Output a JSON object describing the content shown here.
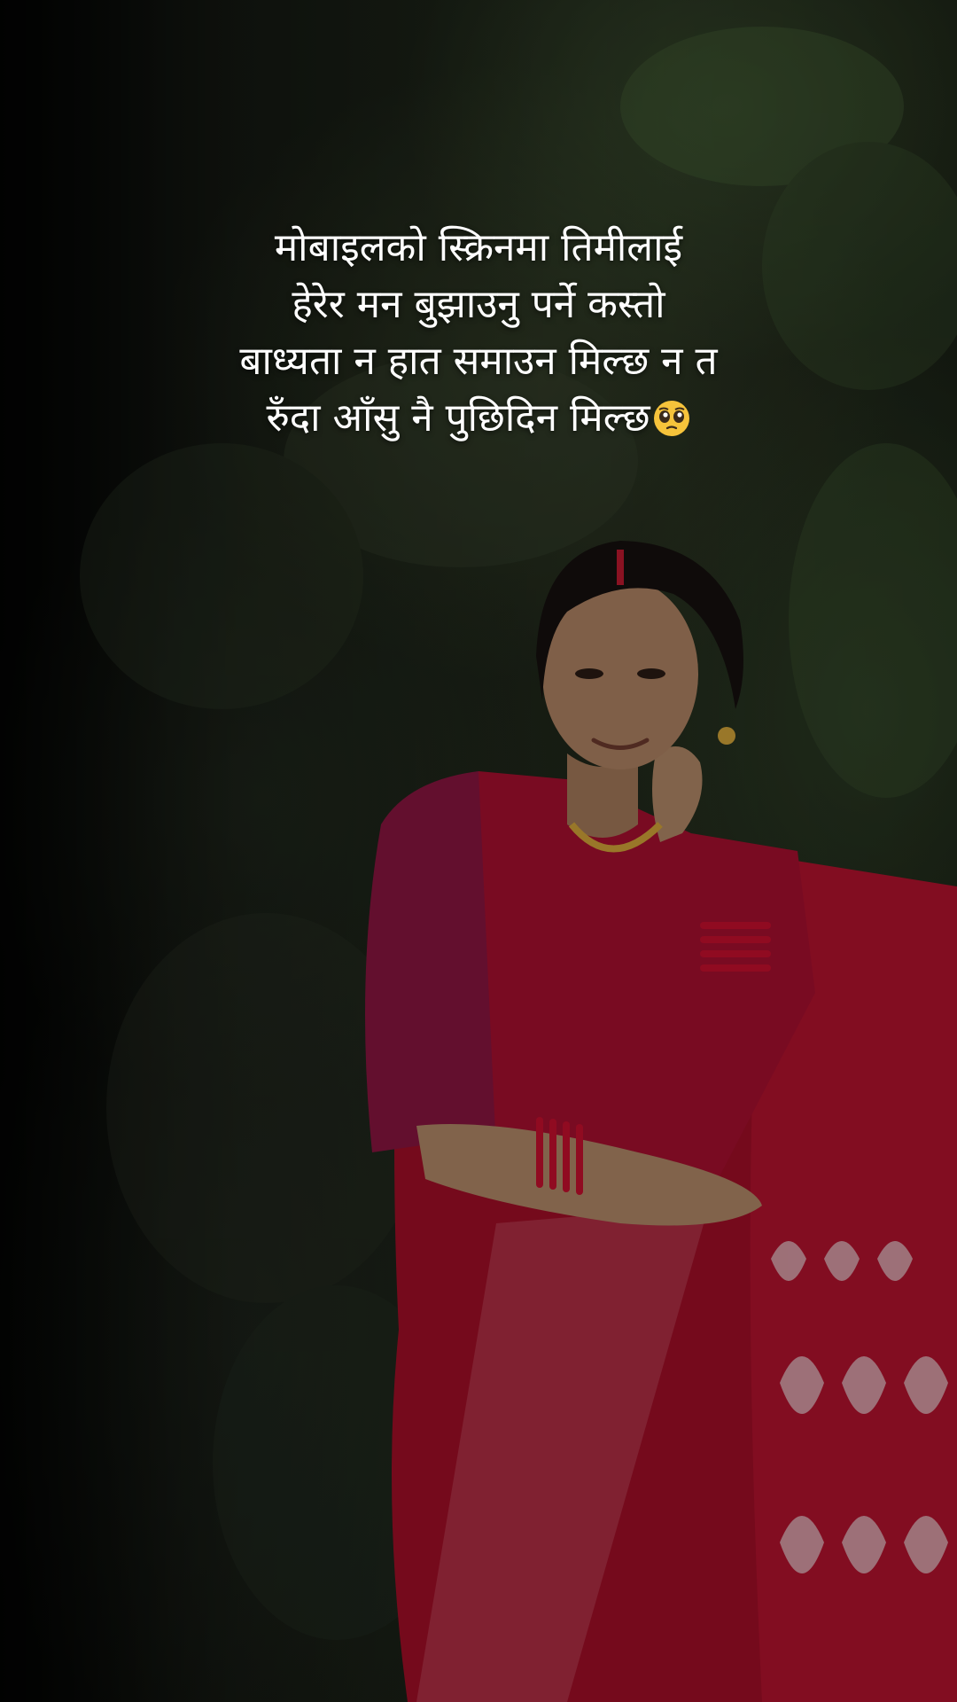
{
  "caption": {
    "line1": "मोबाइलको स्क्रिनमा तिमीलाई",
    "line2": "हेरेर मन बुझाउनु पर्ने कस्तो",
    "line3": "बाध्यता न हात समाउन मिल्छ न त",
    "line4": "रुँदा आँसु नै पुछिदिन मिल्छ",
    "emoji": "pleading-face-emoji"
  },
  "colors": {
    "saree": "#a8102a",
    "blouse": "#8a1540",
    "foliage": "#2a3522",
    "text": "#ffffff"
  }
}
